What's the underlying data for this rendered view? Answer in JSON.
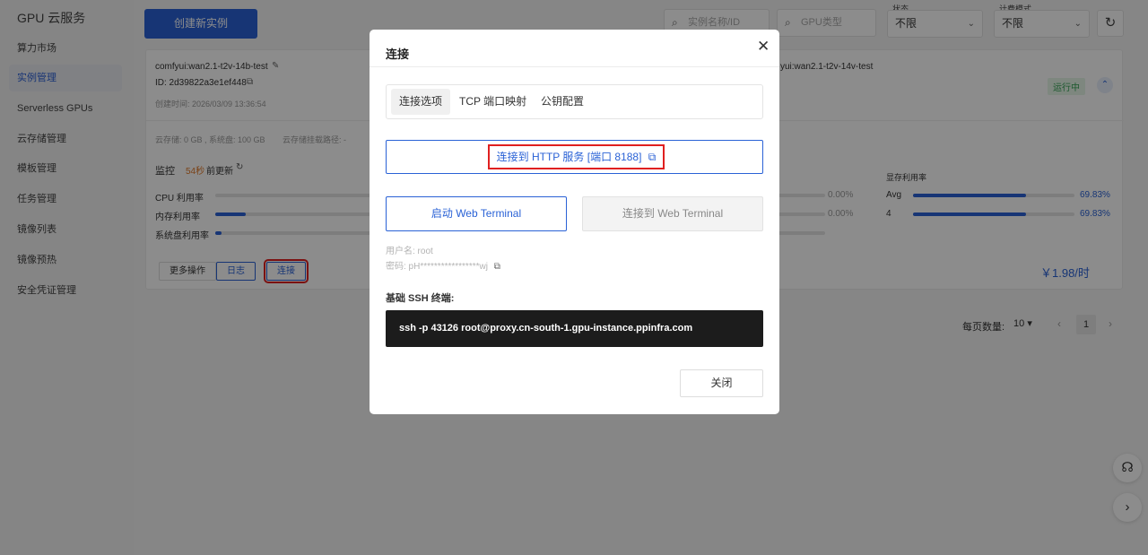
{
  "sidebar": {
    "brand": "GPU 云服务",
    "items": [
      {
        "label": "算力市场"
      },
      {
        "label": "实例管理"
      },
      {
        "label": "Serverless GPUs"
      },
      {
        "label": "云存储管理"
      },
      {
        "label": "模板管理"
      },
      {
        "label": "任务管理"
      },
      {
        "label": "镜像列表"
      },
      {
        "label": "镜像预热"
      },
      {
        "label": "安全凭证管理"
      }
    ]
  },
  "toolbar": {
    "create_label": "创建新实例",
    "search_name_placeholder": "实例名称/ID",
    "search_gpu_placeholder": "GPU类型",
    "status_label": "状态",
    "status_value": "不限",
    "billing_label": "计费模式",
    "billing_value": "不限"
  },
  "instance": {
    "name": "comfyui:wan2.1-t2v-14b-test",
    "id": "ID: 2d39822a3e1ef448",
    "created": "创建时间: 2026/03/09 13:36:54",
    "image_name": "yui:wan2.1-t2v-14v-test",
    "status": "运行中",
    "storage": "云存储: 0 GB , 系统盘: 100 GB",
    "mount": "云存储挂载路径: -",
    "monitor_title": "监控",
    "monitor_age": "54秒",
    "monitor_suffix": "前更新",
    "gpu_util_title": "显存利用率",
    "metrics": [
      {
        "label": "CPU 利用率",
        "value": "0.00%",
        "fraction": 0.0
      },
      {
        "label": "内存利用率",
        "value": "0.00%",
        "fraction": 0.05
      },
      {
        "label": "系统盘利用率",
        "value": "",
        "fraction": 0.01
      }
    ],
    "gpu_rows": [
      {
        "label": "Avg",
        "value": "69.83%",
        "fraction": 0.6983
      },
      {
        "label": "4",
        "value": "69.83%",
        "fraction": 0.6983
      }
    ],
    "more_label": "更多操作",
    "log_label": "日志",
    "connect_label": "连接",
    "price": "￥1.98/时"
  },
  "pager": {
    "label": "每页数量:",
    "size": "10",
    "page": "1"
  },
  "modal": {
    "title": "连接",
    "tabs": [
      {
        "label": "连接选项"
      },
      {
        "label": "TCP 端口映射"
      },
      {
        "label": "公钥配置"
      }
    ],
    "http_label": "连接到 HTTP 服务 [端口 8188]",
    "web_start": "启动 Web Terminal",
    "web_connect": "连接到 Web Terminal",
    "username": "用户名: root",
    "password": "密码: pH*****************wj",
    "ssh_label": "基础 SSH 终端:",
    "ssh_command": "ssh -p 43126 root@proxy.cn-south-1.gpu-instance.ppinfra.com",
    "close_label": "关闭"
  },
  "colors": {
    "accent": "#2a62d6",
    "highlight": "#e02020",
    "status": "#35a254"
  }
}
